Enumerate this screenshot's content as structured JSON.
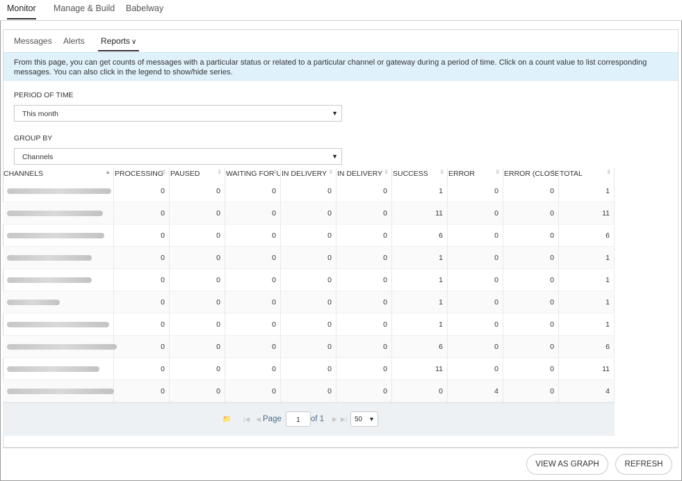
{
  "top_nav": {
    "tabs": [
      "Monitor",
      "Manage & Build",
      "Babelway"
    ]
  },
  "sub_nav": {
    "tabs": [
      "Messages",
      "Alerts",
      "Reports"
    ]
  },
  "info_text": "From this page, you can get counts of messages with a particular status or related to a particular channel or gateway during a period of time. Click on a count value to list corresponding messages. You can also click in the legend to show/hide series.",
  "period": {
    "label": "PERIOD OF TIME",
    "value": "This month"
  },
  "group": {
    "label": "GROUP BY",
    "value": "Channels"
  },
  "table": {
    "headers": [
      "CHANNELS",
      "PROCESSING",
      "PAUSED",
      "WAITING FOR U",
      "IN DELIVERY",
      "IN DELIVERY",
      "SUCCESS",
      "ERROR",
      "ERROR (CLOSEI",
      "TOTAL"
    ],
    "rows": [
      [
        "",
        "0",
        "0",
        "0",
        "0",
        "0",
        "1",
        "0",
        "0",
        "1"
      ],
      [
        "",
        "0",
        "0",
        "0",
        "0",
        "0",
        "11",
        "0",
        "0",
        "11"
      ],
      [
        "",
        "0",
        "0",
        "0",
        "0",
        "0",
        "6",
        "0",
        "0",
        "6"
      ],
      [
        "",
        "0",
        "0",
        "0",
        "0",
        "0",
        "1",
        "0",
        "0",
        "1"
      ],
      [
        "",
        "0",
        "0",
        "0",
        "0",
        "0",
        "1",
        "0",
        "0",
        "1"
      ],
      [
        "",
        "0",
        "0",
        "0",
        "0",
        "0",
        "1",
        "0",
        "0",
        "1"
      ],
      [
        "",
        "0",
        "0",
        "0",
        "0",
        "0",
        "1",
        "0",
        "0",
        "1"
      ],
      [
        "",
        "0",
        "0",
        "0",
        "0",
        "0",
        "6",
        "0",
        "0",
        "6"
      ],
      [
        "",
        "0",
        "0",
        "0",
        "0",
        "0",
        "11",
        "0",
        "0",
        "11"
      ],
      [
        "",
        "0",
        "0",
        "0",
        "0",
        "0",
        "0",
        "4",
        "0",
        "4"
      ]
    ]
  },
  "pager": {
    "page_label": "Page",
    "page": "1",
    "of_label": "of 1",
    "page_size": "50"
  },
  "buttons": {
    "graph": "VIEW AS GRAPH",
    "refresh": "REFRESH"
  }
}
